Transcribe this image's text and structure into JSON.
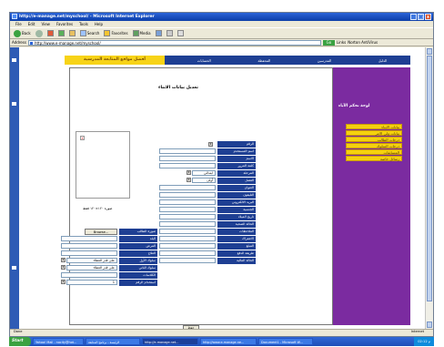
{
  "window": {
    "title": "http://e-manage.net/myschool/ - Microsoft Internet Explorer",
    "controls": [
      "_",
      "□",
      "x"
    ]
  },
  "menubar": [
    "File",
    "Edit",
    "View",
    "Favorites",
    "Tools",
    "Help"
  ],
  "toolbar": {
    "back": "Back",
    "search": "Search",
    "favorites": "Favorites",
    "media": "Media"
  },
  "addressbar": {
    "label": "Address",
    "url": "http://www.e-manage.net/myschool/",
    "go": "Go",
    "links": "Links",
    "norton": "Norton AntiVirus"
  },
  "site": {
    "logo": "أفضل مواقع المتابعة المدرسية",
    "nav": [
      "الدليل",
      "المدرسين",
      "المحفظة",
      "الحسابات"
    ],
    "sidebar_title": "لوحة تحكم الآباء",
    "sidebar_links": [
      "بيانات الابناء",
      "بيانات ولي الامر",
      "درجات الطالب",
      "درجات السلوك",
      "المسابقات",
      "رسائل خاصة"
    ],
    "page_title": "تعديل بيانات الابناء",
    "photo_caption": "صورة ١٢٠×١٢٠ فقط",
    "fields_right": [
      "الرقم",
      "اسم المستخدم",
      "الاسم",
      "كلمة المرور",
      "المرحلة",
      "الفصل",
      "العنوان",
      "التليفون",
      "البريد الالكتروني",
      "الجنسية",
      "تاريخ الميلاد",
      "الحالة الصحية",
      "الملاحظات",
      "الاشتراك",
      "المبلغ",
      "طريقة الدفع",
      "الحالة المالية"
    ],
    "stage_value": "ابتدائي",
    "class_value": "أولى",
    "fields_left": [
      "صورة الطالب",
      "البلد",
      "المرض",
      "العلاج",
      "سلوك الأول",
      "سلوك الثاني",
      "الكلاسات",
      "استخدام الرقم"
    ],
    "browse": "Browse...",
    "behavior1_value": "على قدر العطاء",
    "behavior2_value": "على قدر العطاء",
    "use_number_value": "1",
    "save": "حفظ"
  },
  "status": {
    "left": "Done",
    "zone": "Internet"
  },
  "taskbar": {
    "start": "Start",
    "tasks": [
      "Yahoo! Mail - nocity@hot...",
      "الرئيسة - برنامج المتابعة",
      "http://e-manage.net...",
      "http://www.e-manage.ne...",
      "Document1 - Microsoft W..."
    ],
    "clock": "02:12 م"
  }
}
